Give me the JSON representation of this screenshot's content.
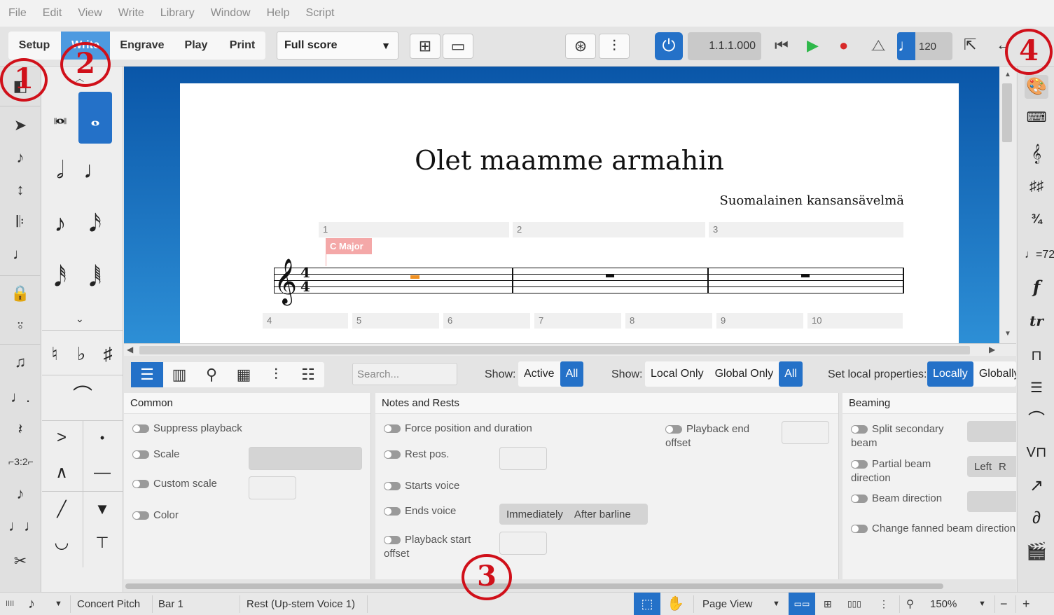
{
  "menu": [
    "File",
    "Edit",
    "View",
    "Write",
    "Library",
    "Window",
    "Help",
    "Script"
  ],
  "modes": {
    "setup": "Setup",
    "write": "Write",
    "engrave": "Engrave",
    "play": "Play",
    "print": "Print"
  },
  "layout_select": "Full score",
  "transport": {
    "timecode": "1.1.1.000",
    "tempo": "120"
  },
  "score": {
    "title": "Olet maamme armahin",
    "composer": "Suomalainen kansansävelmä",
    "bars_row1": [
      "1",
      "2",
      "3"
    ],
    "bars_row2": [
      "4",
      "5",
      "6",
      "7",
      "8",
      "9",
      "10"
    ],
    "key_signpost": "C Major"
  },
  "properties": {
    "search_placeholder": "Search...",
    "show_label": "Show:",
    "show1": [
      "Active",
      "All"
    ],
    "show2": [
      "Local Only",
      "Global Only",
      "All"
    ],
    "set_local_label": "Set local properties:",
    "set_local": [
      "Locally",
      "Globally"
    ],
    "groups": {
      "common": {
        "title": "Common",
        "rows": [
          "Suppress playback",
          "Scale",
          "Custom scale",
          "Color"
        ]
      },
      "notes": {
        "title": "Notes and Rests",
        "rows": [
          "Force position and duration",
          "Rest pos.",
          "Starts voice",
          "Ends voice",
          "Playback start offset",
          "Playback end offset"
        ],
        "ends_voice_options": [
          "Immediately",
          "After barline"
        ]
      },
      "beaming": {
        "title": "Beaming",
        "rows": [
          "Split secondary beam",
          "Partial beam direction",
          "Beam direction",
          "Change fanned beam direction"
        ],
        "partial_options": [
          "Left",
          "R"
        ]
      }
    }
  },
  "status": {
    "pitch": "Concert Pitch",
    "bar": "Bar 1",
    "selection": "Rest (Up-stem Voice 1)",
    "view": "Page View",
    "zoom": "150%"
  },
  "annotations": [
    "1",
    "2",
    "3",
    "4"
  ],
  "colors": {
    "accent": "#2471c8",
    "write_tab": "#4d9ae0",
    "annotation": "#d0101a",
    "signpost": "#f4a8a8"
  }
}
